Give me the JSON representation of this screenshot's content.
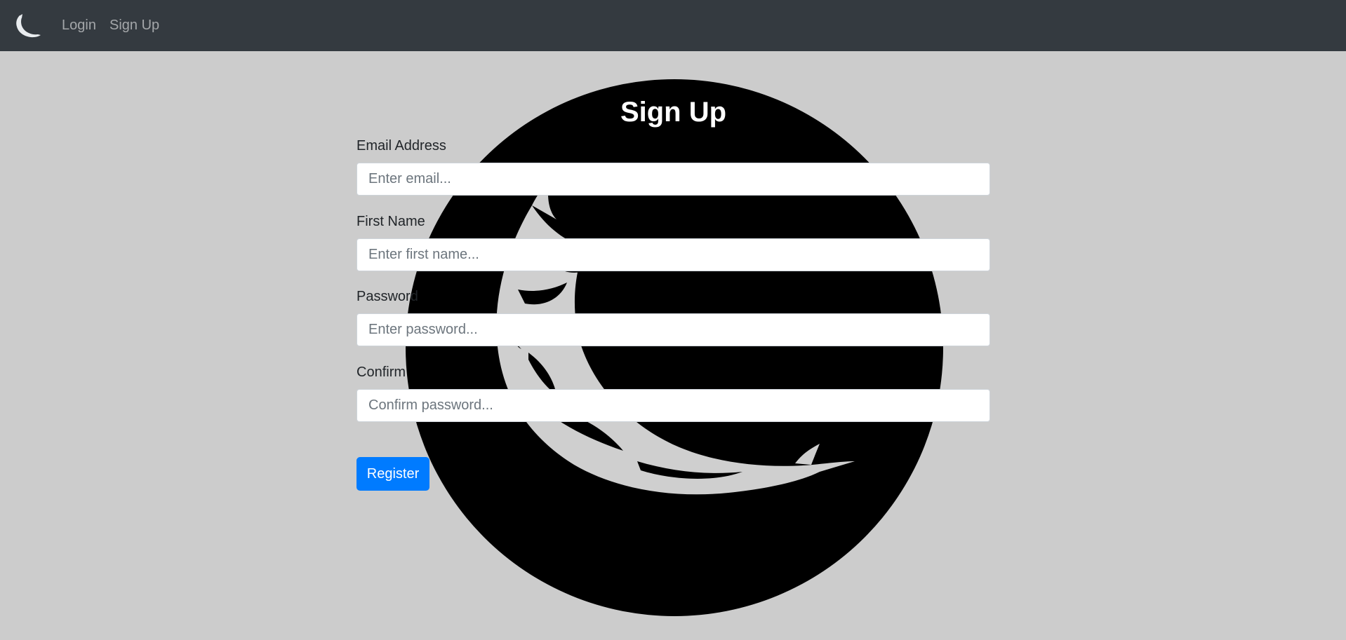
{
  "navbar": {
    "brand_icon": "flask-horn-logo-icon",
    "links": [
      {
        "label": "Login"
      },
      {
        "label": "Sign Up"
      }
    ]
  },
  "form": {
    "title": "Sign Up",
    "fields": [
      {
        "label": "Email Address",
        "placeholder": "Enter email..."
      },
      {
        "label": "First Name",
        "placeholder": "Enter first name..."
      },
      {
        "label": "Password",
        "placeholder": "Enter password..."
      },
      {
        "label": "Confirm",
        "placeholder": "Confirm password..."
      }
    ],
    "submit_label": "Register"
  },
  "colors": {
    "navbar_bg": "#343a40",
    "page_bg": "#cccccc",
    "accent": "#007bff",
    "emblem": "#000000"
  }
}
